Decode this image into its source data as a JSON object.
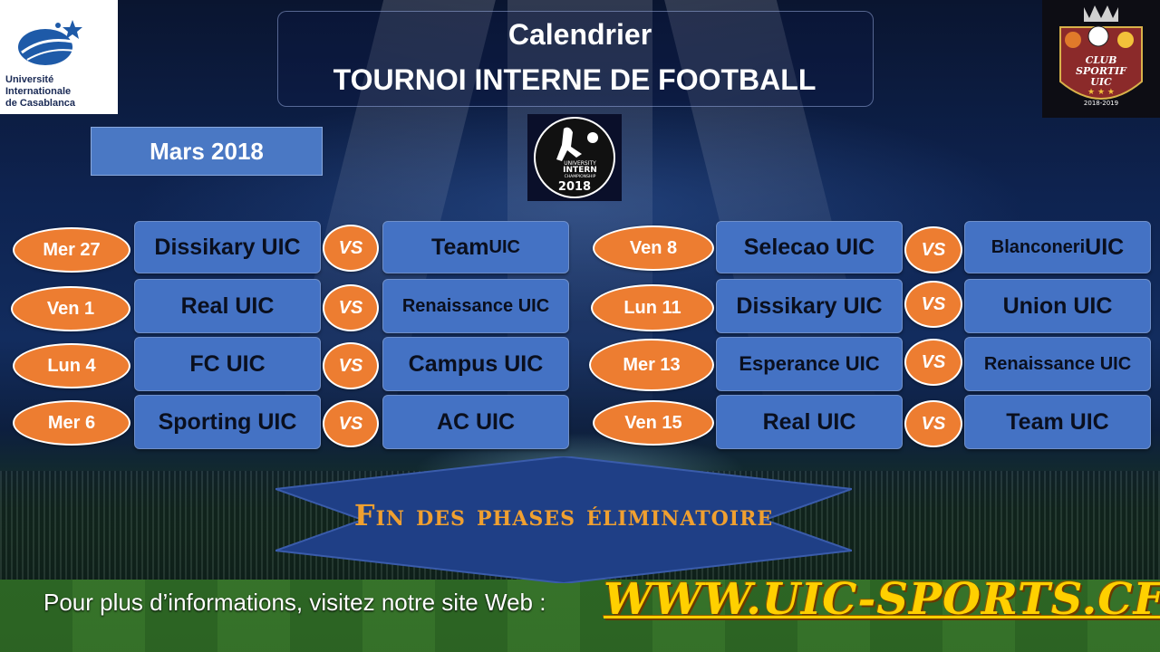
{
  "header": {
    "title_line1": "Calendrier",
    "title_line2": "TOURNOI INTERNE DE FOOTBALL",
    "month": "Mars 2018"
  },
  "logos": {
    "left_caption_line1": "Université Internationale",
    "left_caption_line2": "de Casablanca",
    "right_text_line1": "CLUB",
    "right_text_line2": "SPORTIF",
    "right_text_line3": "UIC",
    "right_years": "2018-2019",
    "center_line1": "UNIVERSITY",
    "center_line2": "INTERN",
    "center_line3": "CHAMPIONSHIP",
    "center_year": "2018"
  },
  "vs_label": "VS",
  "matches_left": [
    {
      "date": "Mer 27",
      "home": "Dissikary UIC",
      "away_main": "Team",
      "away_suffix": " UIC"
    },
    {
      "date": "Ven 1",
      "home": "Real UIC",
      "away_main": "Renaissance  UIC",
      "away_suffix": ""
    },
    {
      "date": "Lun 4",
      "home": "FC UIC",
      "away_main": "Campus UIC",
      "away_suffix": ""
    },
    {
      "date": "Mer 6",
      "home": "Sporting UIC",
      "away_main": "AC UIC",
      "away_suffix": ""
    }
  ],
  "matches_right": [
    {
      "date": "Ven 8",
      "home": "Selecao UIC",
      "away_main": "Blanconeri",
      "away_suffix": " UIC"
    },
    {
      "date": "Lun 11",
      "home": "Dissikary UIC",
      "away_main": "Union UIC",
      "away_suffix": ""
    },
    {
      "date": "Mer 13",
      "home": "Esperance UIC",
      "away_main": "Renaissance UIC",
      "away_suffix": ""
    },
    {
      "date": "Ven 15",
      "home": "Real UIC",
      "away_main": "Team UIC",
      "away_suffix": ""
    }
  ],
  "banner": "Fin des phases éliminatoire",
  "footer": {
    "text": "Pour plus d’informations, visitez notre site Web :",
    "site": "WWW.UIC-SPORTS.CF"
  },
  "colors": {
    "date_bubble": "#ed7d31",
    "team_box": "#4472c4",
    "month_box": "#4a78c4",
    "banner_text": "#f0a030",
    "site_link": "#ffd000"
  }
}
